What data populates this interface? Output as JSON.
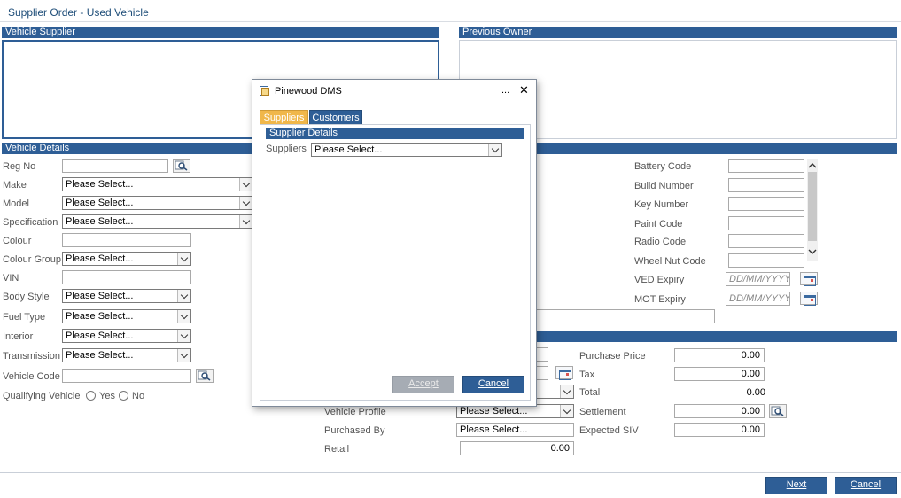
{
  "page": {
    "title": "Supplier Order - Used Vehicle"
  },
  "vehicle_supplier": {
    "header": "Vehicle Supplier"
  },
  "previous_owner": {
    "header": "Previous Owner"
  },
  "vehicle_details": {
    "header": "Vehicle Details",
    "reg_no_label": "Reg No",
    "make_label": "Make",
    "make_value": "Please Select...",
    "model_label": "Model",
    "model_value": "Please Select...",
    "specification_label": "Specification",
    "specification_value": "Please Select...",
    "colour_label": "Colour",
    "colour_group_label": "Colour Group",
    "colour_group_value": "Please Select...",
    "vin_label": "VIN",
    "body_style_label": "Body Style",
    "body_style_value": "Please Select...",
    "fuel_type_label": "Fuel Type",
    "fuel_type_value": "Please Select...",
    "interior_label": "Interior",
    "interior_value": "Please Select...",
    "transmission_label": "Transmission",
    "transmission_value": "Please Select...",
    "vehicle_code_label": "Vehicle Code",
    "qualifying_vehicle_label": "Qualifying Vehicle",
    "yes_label": "Yes",
    "no_label": "No",
    "battery_code_label": "Battery Code",
    "build_number_label": "Build Number",
    "key_number_label": "Key Number",
    "paint_code_label": "Paint Code",
    "radio_code_label": "Radio Code",
    "wheel_nut_code_label": "Wheel Nut Code",
    "ved_expiry_label": "VED Expiry",
    "ved_expiry_placeholder": "DD/MM/YYYY",
    "mot_expiry_label": "MOT Expiry",
    "mot_expiry_placeholder": "DD/MM/YYYY"
  },
  "purchase": {
    "vehicle_profile_label": "Vehicle Profile",
    "vehicle_profile_value": "Please Select...",
    "purchased_by_label": "Purchased By",
    "purchased_by_value": "Please Select...",
    "retail_label": "Retail",
    "retail_value": "0.00",
    "purchase_price_label": "Purchase Price",
    "purchase_price_value": "0.00",
    "tax_label": "Tax",
    "tax_value": "0.00",
    "total_label": "Total",
    "total_value": "0.00",
    "settlement_label": "Settlement",
    "settlement_value": "0.00",
    "expected_siv_label": "Expected SIV",
    "expected_siv_value": "0.00"
  },
  "footer": {
    "next_label": "Next",
    "cancel_label": "Cancel"
  },
  "dialog": {
    "title": "Pinewood DMS",
    "more_label": "...",
    "close_label": "✕",
    "tabs": [
      {
        "label": "Suppliers"
      },
      {
        "label": "Customers"
      }
    ],
    "section_header": "Supplier Details",
    "suppliers_label": "Suppliers",
    "suppliers_value": "Please Select...",
    "accept_label": "Accept",
    "cancel_label": "Cancel"
  },
  "colors": {
    "accent": "#2e5e96",
    "active_tab": "#f0b74a",
    "title_text": "#1f4e79",
    "disabled_button": "#a6acb4"
  },
  "icons": [
    "search-icon",
    "calendar-icon",
    "radio-button",
    "chevron-up-icon",
    "chevron-down-icon",
    "window-icon",
    "close-icon"
  ]
}
